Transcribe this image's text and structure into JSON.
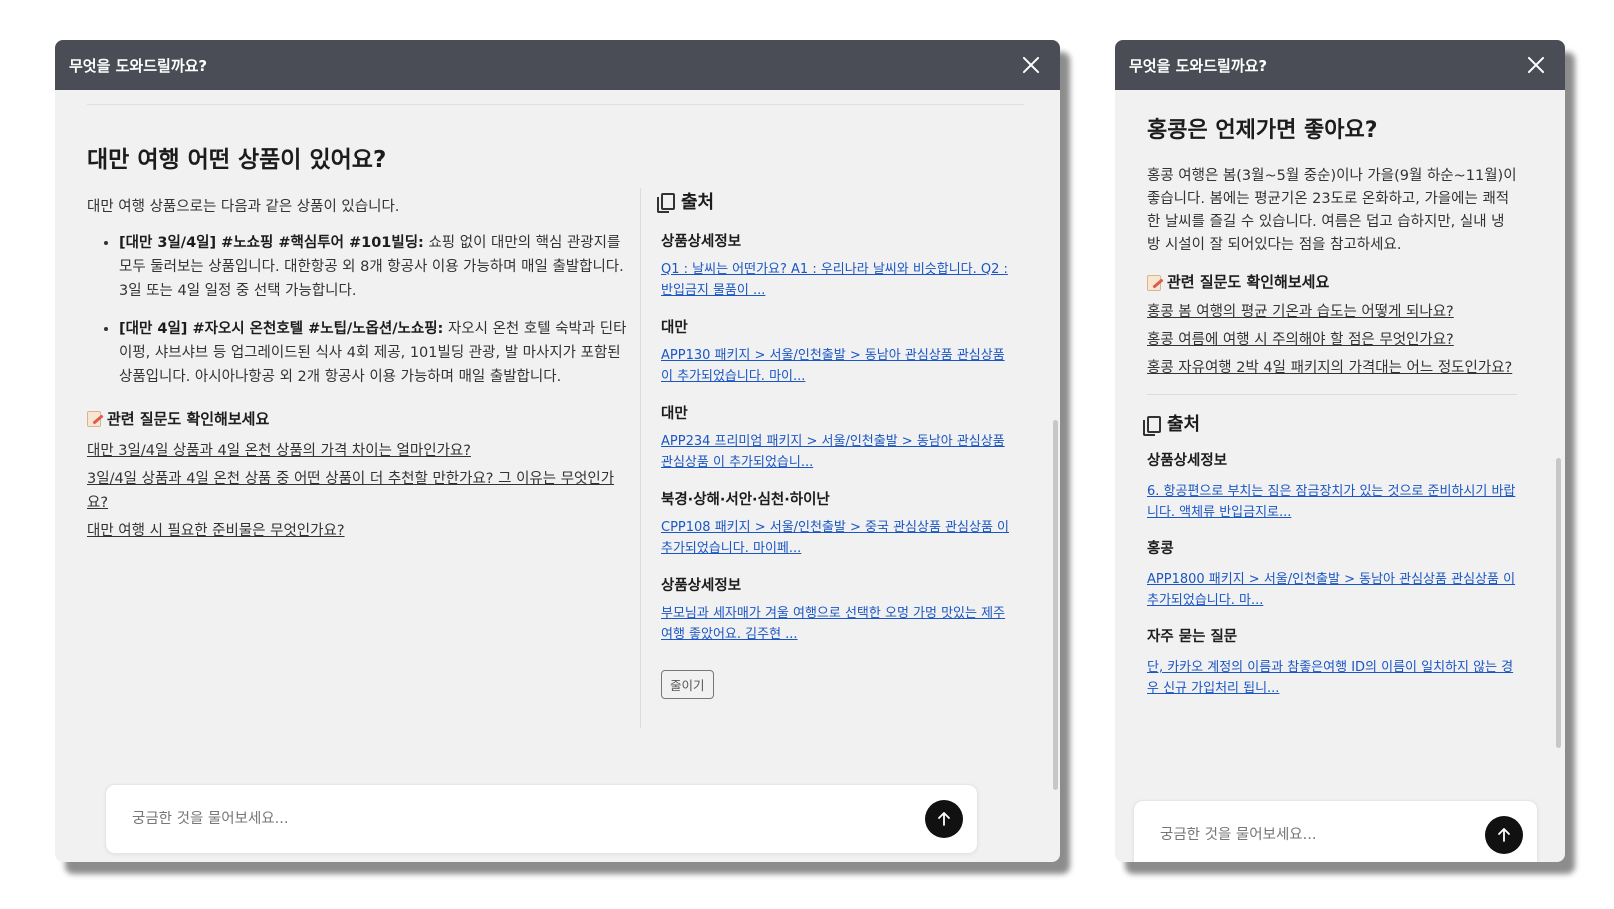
{
  "left_panel": {
    "header_title": "무엇을 도와드릴까요?",
    "question": "대만 여행 어떤 상품이 있어요?",
    "answer_intro": "대만 여행 상품으로는 다음과 같은 상품이 있습니다.",
    "answer_items": [
      {
        "bold": "[대만 3일/4일] #노쇼핑 #핵심투어 #101빌딩:",
        "text": " 쇼핑 없이 대만의 핵심 관광지를 모두 둘러보는 상품입니다. 대한항공 외 8개 항공사 이용 가능하며 매일 출발합니다. 3일 또는 4일 일정 중 선택 가능합니다."
      },
      {
        "bold": "[대만 4일] #자오시 온천호텔 #노팁/노옵션/노쇼핑:",
        "text": " 자오시 온천 호텔 숙박과 딘타이펑, 샤브샤브 등 업그레이드된 식사 4회 제공, 101빌딩 관광, 발 마사지가 포함된 상품입니다. 아시아나항공 외 2개 항공사 이용 가능하며 매일 출발합니다."
      }
    ],
    "related_title": "관련 질문도 확인해보세요",
    "related_links": [
      "대만 3일/4일 상품과 4일 온천 상품의 가격 차이는 얼마인가요?",
      "3일/4일 상품과 4일 온천 상품 중 어떤 상품이 더 추천할 만한가요? 그 이유는 무엇인가요?",
      "대만 여행 시 필요한 준비물은 무엇인가요?"
    ],
    "sources_title": "출처",
    "sources": [
      {
        "heading": "상품상세정보",
        "link": "Q1 : 날씨는 어떤가요? A1 : 우리나라 날씨와 비슷합니다. Q2 : 반입금지 물품이 ..."
      },
      {
        "heading": "대만",
        "link": "APP130 패키지 > 서울/인천출발 > 동남아 관심상품 관심상품 이 추가되었습니다. 마이..."
      },
      {
        "heading": "대만",
        "link": "APP234 프리미엄 패키지 > 서울/인천출발 > 동남아 관심상품 관심상품 이 추가되었습니..."
      },
      {
        "heading": "북경·상해·서안·심천·하이난",
        "link": "CPP108 패키지 > 서울/인천출발 > 중국 관심상품 관심상품 이 추가되었습니다. 마이페..."
      },
      {
        "heading": "상품상세정보",
        "link": "부모님과 세자매가 겨울 여행으로 선택한 오멍 가멍 맛있는 제주여행 좋았어요. 김주현 ..."
      }
    ],
    "collapse_label": "줄이기",
    "input_placeholder": "궁금한 것을 물어보세요..."
  },
  "right_panel": {
    "header_title": "무엇을 도와드릴까요?",
    "question": "홍콩은 언제가면 좋아요?",
    "answer": "홍콩 여행은 봄(3월~5월 중순)이나 가을(9월 하순~11월)이 좋습니다. 봄에는 평균기온 23도로 온화하고, 가을에는 쾌적한 날씨를 즐길 수 있습니다. 여름은 덥고 습하지만, 실내 냉방 시설이 잘 되어있다는 점을 참고하세요.",
    "related_title": "관련 질문도 확인해보세요",
    "related_links": [
      "홍콩 봄 여행의 평균 기온과 습도는 어떻게 되나요?",
      "홍콩 여름에 여행 시 주의해야 할 점은 무엇인가요?",
      "홍콩 자유여행 2박 4일 패키지의 가격대는 어느 정도인가요?"
    ],
    "sources_title": "출처",
    "sources": [
      {
        "heading": "상품상세정보",
        "link": "6. 항공편으로 부치는 짐은 잠금장치가 있는 것으로 준비하시기 바랍니다. 액체류 반입금지로..."
      },
      {
        "heading": "홍콩",
        "link": "APP1800 패키지 > 서울/인천출발 > 동남아 관심상품 관심상품 이 추가되었습니다. 마..."
      },
      {
        "heading": "자주 묻는 질문",
        "link": "단, 카카오 계정의 이름과 참좋은여행 ID의 이름이 일치하지 않는 경우 신규 가입처리 됩니..."
      }
    ],
    "input_placeholder": "궁금한 것을 물어보세요..."
  },
  "icons": [
    "close-icon",
    "memo-icon",
    "document-icon",
    "arrow-up-icon"
  ],
  "colors": {
    "header_bg": "#4a4d55",
    "panel_bg": "#f1f1f1",
    "link_blue": "#1a56c4",
    "send_button": "#111111"
  }
}
